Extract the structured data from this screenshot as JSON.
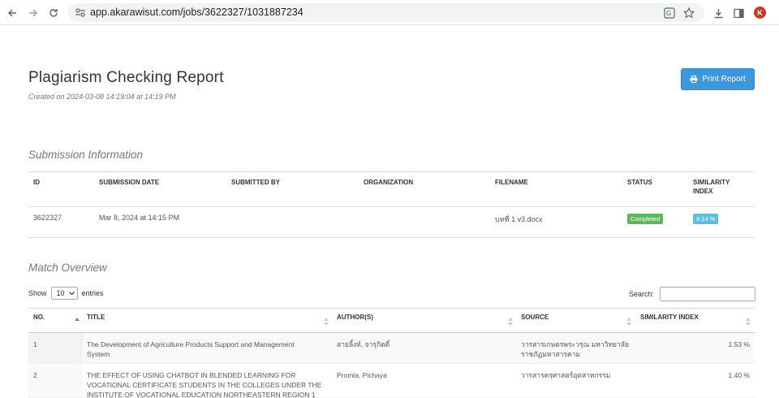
{
  "browser": {
    "url": "app.akarawisut.com/jobs/3622327/1031887234",
    "avatar_letter": "K",
    "avatar_color": "#c9391f"
  },
  "header": {
    "title": "Plagiarism Checking Report",
    "created": "Created on 2024-03-08 14:19:04 at 14:19 PM",
    "print_label": "Print Report",
    "accent": "#3c97dd"
  },
  "submission": {
    "section_title": "Submission Information",
    "columns": [
      "ID",
      "SUBMISSION DATE",
      "SUBMITTED BY",
      "ORGANIZATION",
      "FILENAME",
      "STATUS",
      "SIMILARITY",
      "INDEX"
    ],
    "row": {
      "id": "3622327",
      "date": "Mar 8, 2024 at 14:15 PM",
      "submitted_by": "",
      "organization": "",
      "filename": "บทที่ 1 v3.docx",
      "status": "Completed",
      "similarity": "9.14 %"
    }
  },
  "match": {
    "section_title": "Match Overview",
    "show_label": "Show",
    "entries_value": "10",
    "entries_label": "entries",
    "search_label": "Search:",
    "columns": [
      "NO.",
      "TITLE",
      "AUTHOR(S)",
      "SOURCE",
      "SIMILARITY INDEX"
    ],
    "rows": [
      {
        "no": "1",
        "title_line1": "The Development of Agriculture Products Support and Management",
        "title_line2": "System",
        "title_line3": "",
        "author": "สายลิ้งห์, จารุกิตติ์",
        "source_line1": "วารสารเกษตรพระวรุณ มหาวิทยาลัย",
        "source_line2": "ราชภัฏมหาสารคาม",
        "similarity": "1.53 %"
      },
      {
        "no": "2",
        "title_line1": "THE EFFECT OF USING CHATBOT IN BLENDED LEARNING FOR",
        "title_line2": "VOCATIONAL CERTIFICATE STUDENTS IN THE COLLEGES UNDER THE",
        "title_line3": "INSTITUTE OF VOCATIONAL EDUCATION NORTHEASTERN REGION 1",
        "author": "Promla, Pichaya",
        "source_line1": "วารสารครุศาสตร์อุตสาหกรรม",
        "source_line2": "",
        "similarity": "1.40 %"
      }
    ]
  }
}
